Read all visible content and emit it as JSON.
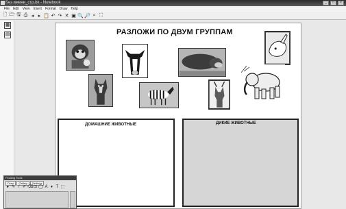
{
  "window": {
    "title": "Без имени_стр.bk - Notebook",
    "buttons": [
      "_",
      "□",
      "×"
    ]
  },
  "menu": [
    "File",
    "Edit",
    "View",
    "Insert",
    "Format",
    "Draw",
    "Help"
  ],
  "toolbar_icons": [
    "new-page-icon",
    "open-icon",
    "save-icon",
    "print-icon",
    "previous-icon",
    "next-icon",
    "paste-icon",
    "undo-icon",
    "redo-icon",
    "delete-icon",
    "screenshade-icon",
    "zoom-in-icon",
    "zoom-out-icon",
    "magnifier-icon",
    "fullscreen-icon"
  ],
  "toolbar_glyphs": [
    "🗋",
    "🗁",
    "🖫",
    "⎙",
    "◂",
    "▸",
    "📋",
    "↶",
    "↷",
    "✕",
    "▣",
    "🔍",
    "🔎",
    "⌕",
    "⛶"
  ],
  "left_panel": {
    "buttons": [
      "▦",
      "▤"
    ]
  },
  "slide": {
    "title": "РАЗЛОЖИ ПО ДВУМ ГРУППАМ",
    "domestic_label": "ДОМАШНИЕ ЖИВОТНЫЕ",
    "wild_label": "ДИКИЕ ЖИВОТНЫЕ"
  },
  "pictures": [
    "monkey",
    "cow",
    "hippo",
    "rabbit",
    "dog",
    "zebra",
    "deer",
    "elephant"
  ],
  "palette": {
    "title": "Floating Tools",
    "tabs": [
      "Draw",
      "Gallery",
      "Settings"
    ],
    "tool_glyphs": [
      "▸",
      "✎",
      "⁄",
      "✐",
      "⌫",
      "⊡",
      "◯",
      "A",
      "▾",
      "T",
      "⬚"
    ]
  },
  "colors": {
    "wild_box_fill": "#d6d6d6",
    "domestic_box_fill": "#ffffff"
  }
}
